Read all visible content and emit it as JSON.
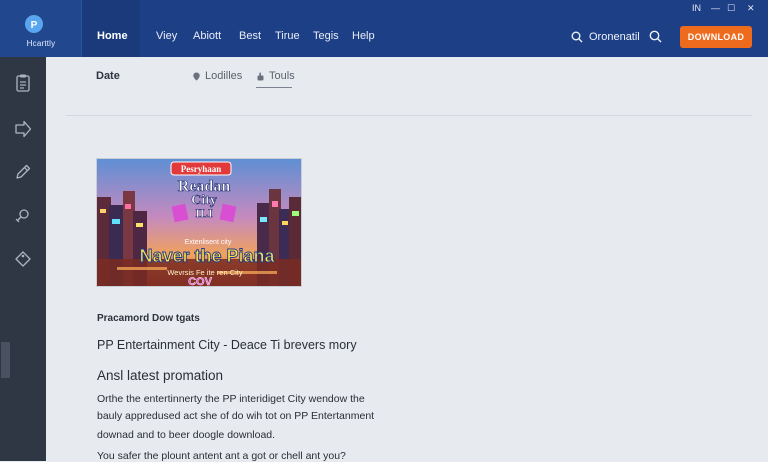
{
  "header": {
    "logo_text": "Hcarttly",
    "nav": [
      {
        "label": "Home",
        "active": true
      },
      {
        "label": "Viey"
      },
      {
        "label": "Abiott"
      },
      {
        "label": "Best"
      },
      {
        "label": "Tirue"
      },
      {
        "label": "Tegis"
      },
      {
        "label": "Help"
      }
    ],
    "window_controls": {
      "lang": "IN",
      "minimize": "—",
      "maximize": "☐",
      "close": "✕"
    },
    "search_label": "Oronenatil",
    "download_label": "DOWNLOAD"
  },
  "subnav": {
    "date_label": "Date",
    "tabs": [
      {
        "label": "Lodilles"
      },
      {
        "label": "Touls",
        "active": true
      }
    ]
  },
  "banner": {
    "badge": "Pesryhaan",
    "title_line1": "Readan",
    "title_line2": "City",
    "title_line3": "ILI",
    "small_text": "Extenlisent city",
    "headline": "Naver the Piana",
    "sub_text": "Wevrsis Fe ite ren City",
    "logo_text": "COV"
  },
  "content": {
    "section_label": "Pracamord Dow tgats",
    "title": "PP Entertainment City - Deace Ti brevers mory",
    "subtitle": "Ansl latest promation",
    "paragraph_lines": [
      "Orthe the entertinnerty the PP interidiget City wendow the",
      "bauly appredused act she of do wih tot on PP Entertanment",
      "downad and to beer doogle download."
    ],
    "footer_line": "You safer the plount antent ant a got or chell ant you?"
  },
  "colors": {
    "header": "#1d3f86",
    "sidebar": "#2f3745",
    "background": "#e7eaef",
    "accent": "#ee6a1c"
  }
}
